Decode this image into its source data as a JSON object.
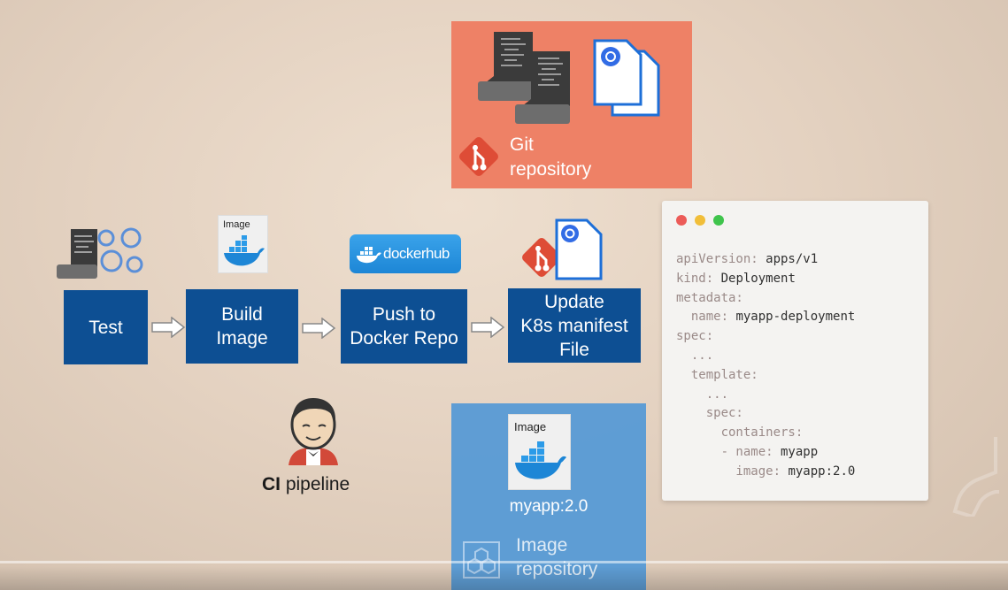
{
  "git_repository": {
    "label_line1": "Git",
    "label_line2": "repository"
  },
  "steps": [
    {
      "label_line1": "Test"
    },
    {
      "label_line1": "Build",
      "label_line2": "Image",
      "icon_caption": "Image"
    },
    {
      "label_line1": "Push to",
      "label_line2": "Docker Repo",
      "badge": "dockerhub"
    },
    {
      "label_line1": "Update",
      "label_line2": "K8s manifest",
      "label_line3": "File"
    }
  ],
  "ci_pipeline": {
    "label_bold": "CI",
    "label_rest": " pipeline"
  },
  "image_repository": {
    "icon_caption": "Image",
    "tag": "myapp:2.0",
    "label_line1": "Image",
    "label_line2": "repository"
  },
  "manifest": {
    "lines": [
      {
        "key": "apiVersion:",
        "value": " apps/v1"
      },
      {
        "key": "kind:",
        "value": " Deployment"
      },
      {
        "key": "metadata:",
        "value": ""
      },
      {
        "key": "  name:",
        "value": " myapp-deployment"
      },
      {
        "key": "spec:",
        "value": ""
      },
      {
        "key": "  ...",
        "value": ""
      },
      {
        "key": "  template:",
        "value": ""
      },
      {
        "key": "    ...",
        "value": ""
      },
      {
        "key": "    spec:",
        "value": ""
      },
      {
        "key": "      containers:",
        "value": ""
      },
      {
        "key": "      - name:",
        "value": " myapp"
      },
      {
        "key": "        image:",
        "value": " myapp:2.0"
      }
    ]
  },
  "colors": {
    "git": "#ee8166",
    "step": "#0d4f93",
    "image_repo": "#5a9bd5",
    "docker": "#1d86d6"
  }
}
